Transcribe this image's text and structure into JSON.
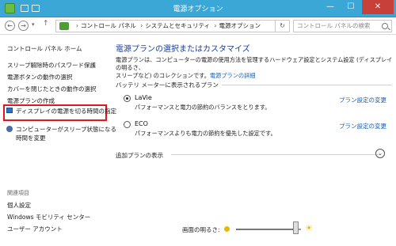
{
  "window": {
    "title": "電源オプション",
    "minimize": "—",
    "maximize": "☐",
    "close": "✕"
  },
  "address": {
    "back": "←",
    "forward": "→",
    "history": "▾",
    "up": "↑",
    "crumbs": [
      "コントロール パネル",
      "システムとセキュリティ",
      "電源オプション"
    ],
    "separator": "›",
    "refresh": "↻",
    "search_placeholder": "コントロール パネルの検索"
  },
  "left": {
    "home": "コントロール パネル ホーム",
    "links": [
      "スリープ解除時のパスワード保護",
      "電源ボタンの動作の選択",
      "カバーを閉じたときの動作の選択",
      "電源プランの作成",
      "ディスプレイの電源を切る時間の指定",
      "コンピューターがスリープ状態になる",
      "時間を変更"
    ],
    "related_label": "関連項目",
    "related": [
      "個人設定",
      "Windows モビリティ センター",
      "ユーザー アカウント"
    ]
  },
  "main": {
    "title": "電源プランの選択またはカスタマイズ",
    "desc_line1": "電源プランは、コンピューターの電源の使用方法を管理するハードウェア設定とシステム設定 (ディスプレイの明るさ、",
    "desc_line2": "スリープなど) のコレクションです。",
    "desc_link": "電源プランの詳細",
    "group_label": "バッテリ メーターに表示されるプラン",
    "plans": [
      {
        "name": "LaVie",
        "desc": "パフォーマンスと電力の節約のバランスをとります。",
        "link": "プラン設定の変更",
        "selected": true
      },
      {
        "name": "ECO",
        "desc": "パフォーマンスよりも電力の節約を優先した設定です。",
        "link": "プラン設定の変更",
        "selected": false
      }
    ],
    "extra_label": "追加プランの表示",
    "expand_icon": "⌄"
  },
  "brightness": {
    "label": "画面の明るさ:",
    "level": 0.92,
    "sun_icon": "☀"
  }
}
